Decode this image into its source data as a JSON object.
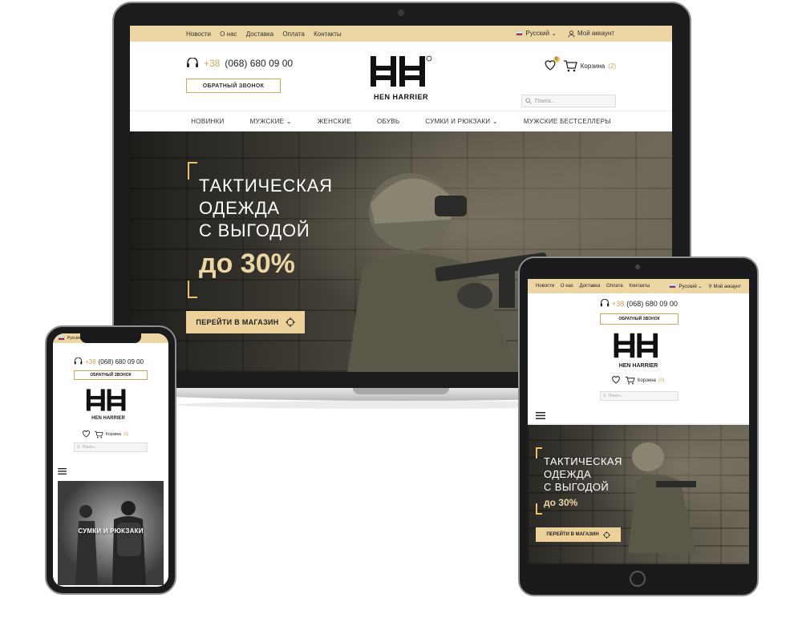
{
  "brand": {
    "name": "HEN HARRIER",
    "logo_letters": "HH",
    "accent_color": "#ecd6a3",
    "button_color": "#ecd19b",
    "gold_text_color": "#c9a45a"
  },
  "topbar": {
    "links": [
      "Новости",
      "О нас",
      "Доставка",
      "Оплата",
      "Контакты"
    ],
    "language": "Русский",
    "account": "Мой аккаунт"
  },
  "header": {
    "phone_code": "+38",
    "phone_number": "(068) 680 09 00",
    "callback_label": "ОБРАТНЫЙ ЗВОНОК",
    "cart_label": "Корзина",
    "cart_count": "(2)",
    "wishlist_count": "0",
    "search_placeholder": "Поиск..."
  },
  "nav": {
    "items": [
      "НОВИНКИ",
      "МУЖСКИЕ",
      "ЖЕНСКИЕ",
      "ОБУВЬ",
      "СУМКИ И РЮКЗАКИ",
      "МУЖСКИЕ БЕСТСЕЛЛЕРЫ"
    ]
  },
  "hero": {
    "line1": "ТАКТИЧЕСКАЯ",
    "line2": "ОДЕЖДА",
    "line3": "С ВЫГОДОЙ",
    "accent": "до 30%",
    "button_label": "ПЕРЕЙТИ В МАГАЗИН"
  },
  "tablet": {
    "callback_label": "ОБРАТНЫЙ ЗВОНОК",
    "cart_count": "(0)",
    "button_label": "ПЕРЕЙТИ В МАГАЗИН"
  },
  "phone_device": {
    "language": "Русский",
    "cart_count": "(0)",
    "banner_label": "СУМКИ И РЮКЗАКИ"
  }
}
